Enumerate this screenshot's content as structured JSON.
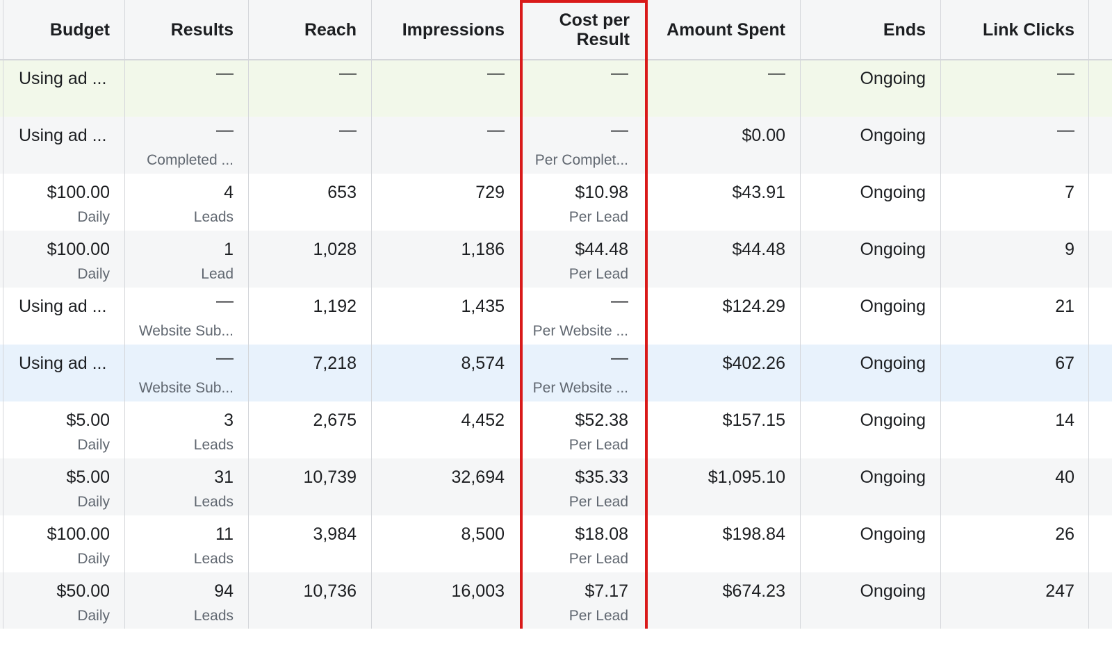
{
  "columns": [
    {
      "key": "budget",
      "label": "Budget"
    },
    {
      "key": "results",
      "label": "Results"
    },
    {
      "key": "reach",
      "label": "Reach"
    },
    {
      "key": "impressions",
      "label": "Impressions"
    },
    {
      "key": "cost",
      "label": "Cost per Result"
    },
    {
      "key": "spent",
      "label": "Amount Spent"
    },
    {
      "key": "ends",
      "label": "Ends"
    },
    {
      "key": "clicks",
      "label": "Link Clicks"
    }
  ],
  "highlight_color": "#d91a1a",
  "rows": [
    {
      "bg": "#f2f8ea",
      "budget": "Using ad ...",
      "budget_sub": "",
      "results": "—",
      "results_sub": "",
      "reach": "—",
      "impressions": "—",
      "cost": "—",
      "cost_sub": "",
      "spent": "—",
      "ends": "Ongoing",
      "clicks": "—"
    },
    {
      "bg": "#f5f6f7",
      "budget": "Using ad ...",
      "budget_sub": "",
      "results": "—",
      "results_sub": "Completed ...",
      "reach": "—",
      "impressions": "—",
      "cost": "—",
      "cost_sub": "Per Complet...",
      "spent": "$0.00",
      "ends": "Ongoing",
      "clicks": "—"
    },
    {
      "bg": "#ffffff",
      "budget": "$100.00",
      "budget_sub": "Daily",
      "results": "4",
      "results_sub": "Leads",
      "reach": "653",
      "impressions": "729",
      "cost": "$10.98",
      "cost_sub": "Per Lead",
      "spent": "$43.91",
      "ends": "Ongoing",
      "clicks": "7"
    },
    {
      "bg": "#f5f6f7",
      "budget": "$100.00",
      "budget_sub": "Daily",
      "results": "1",
      "results_sub": "Lead",
      "reach": "1,028",
      "impressions": "1,186",
      "cost": "$44.48",
      "cost_sub": "Per Lead",
      "spent": "$44.48",
      "ends": "Ongoing",
      "clicks": "9"
    },
    {
      "bg": "#ffffff",
      "budget": "Using ad ...",
      "budget_sub": "",
      "results": "—",
      "results_sub": "Website Sub...",
      "reach": "1,192",
      "impressions": "1,435",
      "cost": "—",
      "cost_sub": "Per Website ...",
      "spent": "$124.29",
      "ends": "Ongoing",
      "clicks": "21"
    },
    {
      "bg": "#e8f2fc",
      "budget": "Using ad ...",
      "budget_sub": "",
      "results": "—",
      "results_sub": "Website Sub...",
      "reach": "7,218",
      "impressions": "8,574",
      "cost": "—",
      "cost_sub": "Per Website ...",
      "spent": "$402.26",
      "ends": "Ongoing",
      "clicks": "67"
    },
    {
      "bg": "#ffffff",
      "budget": "$5.00",
      "budget_sub": "Daily",
      "results": "3",
      "results_sub": "Leads",
      "reach": "2,675",
      "impressions": "4,452",
      "cost": "$52.38",
      "cost_sub": "Per Lead",
      "spent": "$157.15",
      "ends": "Ongoing",
      "clicks": "14"
    },
    {
      "bg": "#f5f6f7",
      "budget": "$5.00",
      "budget_sub": "Daily",
      "results": "31",
      "results_sub": "Leads",
      "reach": "10,739",
      "impressions": "32,694",
      "cost": "$35.33",
      "cost_sub": "Per Lead",
      "spent": "$1,095.10",
      "ends": "Ongoing",
      "clicks": "40"
    },
    {
      "bg": "#ffffff",
      "budget": "$100.00",
      "budget_sub": "Daily",
      "results": "11",
      "results_sub": "Leads",
      "reach": "3,984",
      "impressions": "8,500",
      "cost": "$18.08",
      "cost_sub": "Per Lead",
      "spent": "$198.84",
      "ends": "Ongoing",
      "clicks": "26"
    },
    {
      "bg": "#f5f6f7",
      "budget": "$50.00",
      "budget_sub": "Daily",
      "results": "94",
      "results_sub": "Leads",
      "reach": "10,736",
      "impressions": "16,003",
      "cost": "$7.17",
      "cost_sub": "Per Lead",
      "spent": "$674.23",
      "ends": "Ongoing",
      "clicks": "247"
    }
  ]
}
